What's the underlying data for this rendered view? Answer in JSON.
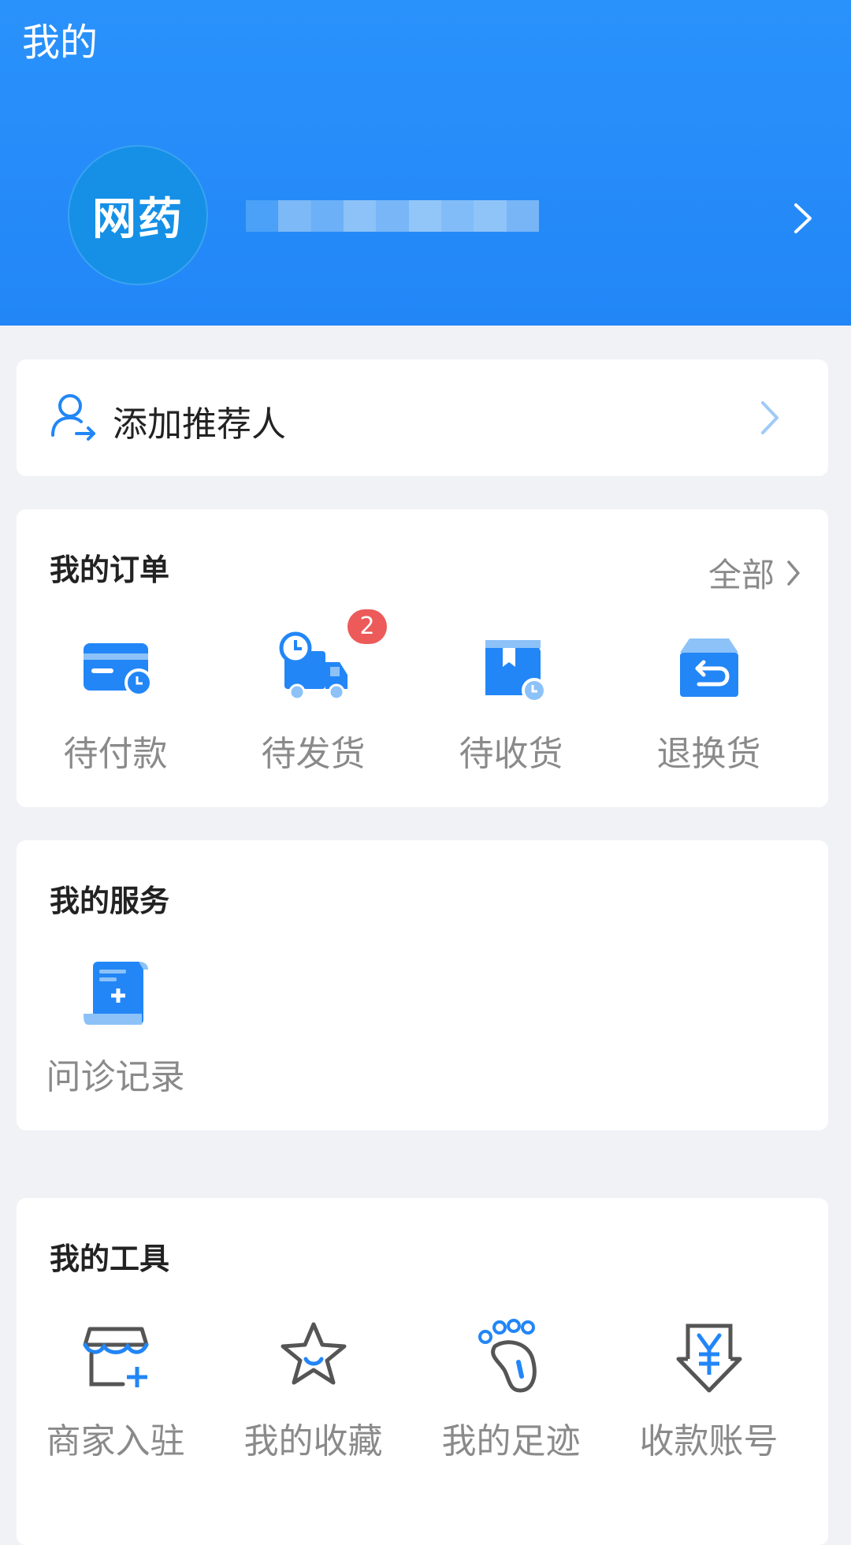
{
  "page": {
    "title": "我的"
  },
  "profile": {
    "avatar_text": "网药"
  },
  "referrer": {
    "label": "添加推荐人"
  },
  "orders": {
    "title": "我的订单",
    "all_label": "全部",
    "items": [
      {
        "label": "待付款",
        "icon": "card-icon"
      },
      {
        "label": "待发货",
        "icon": "truck-icon",
        "badge": "2"
      },
      {
        "label": "待收货",
        "icon": "box-icon"
      },
      {
        "label": "退换货",
        "icon": "return-icon"
      }
    ]
  },
  "services": {
    "title": "我的服务",
    "items": [
      {
        "label": "问诊记录",
        "icon": "scroll-icon"
      }
    ]
  },
  "tools": {
    "title": "我的工具",
    "items": [
      {
        "label": "商家入驻",
        "icon": "store-icon"
      },
      {
        "label": "我的收藏",
        "icon": "star-icon"
      },
      {
        "label": "我的足迹",
        "icon": "footprint-icon"
      },
      {
        "label": "收款账号",
        "icon": "yuan-icon"
      }
    ]
  },
  "colors": {
    "primary": "#2286f7",
    "badge": "#ec5a5a",
    "background": "#f1f2f6"
  }
}
